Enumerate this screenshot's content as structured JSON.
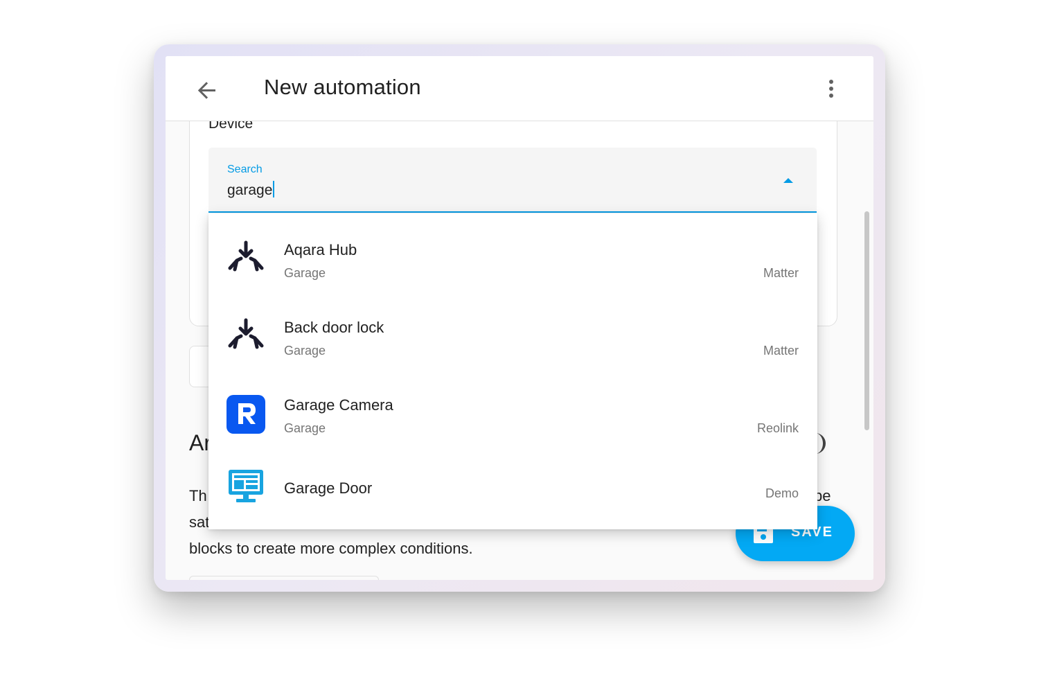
{
  "header": {
    "title": "New automation"
  },
  "device_card": {
    "label": "Device",
    "search": {
      "label": "Search",
      "value": "garage"
    }
  },
  "dropdown": {
    "items": [
      {
        "name": "Aqara Hub",
        "area": "Garage",
        "integration": "Matter",
        "icon": "matter-icon"
      },
      {
        "name": "Back door lock",
        "area": "Garage",
        "integration": "Matter",
        "icon": "matter-icon"
      },
      {
        "name": "Garage Camera",
        "area": "Garage",
        "integration": "Reolink",
        "icon": "reolink-icon"
      },
      {
        "name": "Garage Door",
        "area": "",
        "integration": "Demo",
        "icon": "demo-monitor-icon"
      }
    ]
  },
  "conditions": {
    "heading_partial": "Ar",
    "desc_line1_partial": "Th",
    "desc_line1_end": "pe",
    "desc_line2_partial": "sat",
    "desc_line3": "blocks to create more complex conditions."
  },
  "fab": {
    "label": "SAVE"
  },
  "colors": {
    "accent": "#03a9f4",
    "field_focus": "#039be5",
    "matter_icon": "#1c1c2e",
    "reolink_icon": "#0958f0",
    "demo_icon": "#18a4e0"
  }
}
